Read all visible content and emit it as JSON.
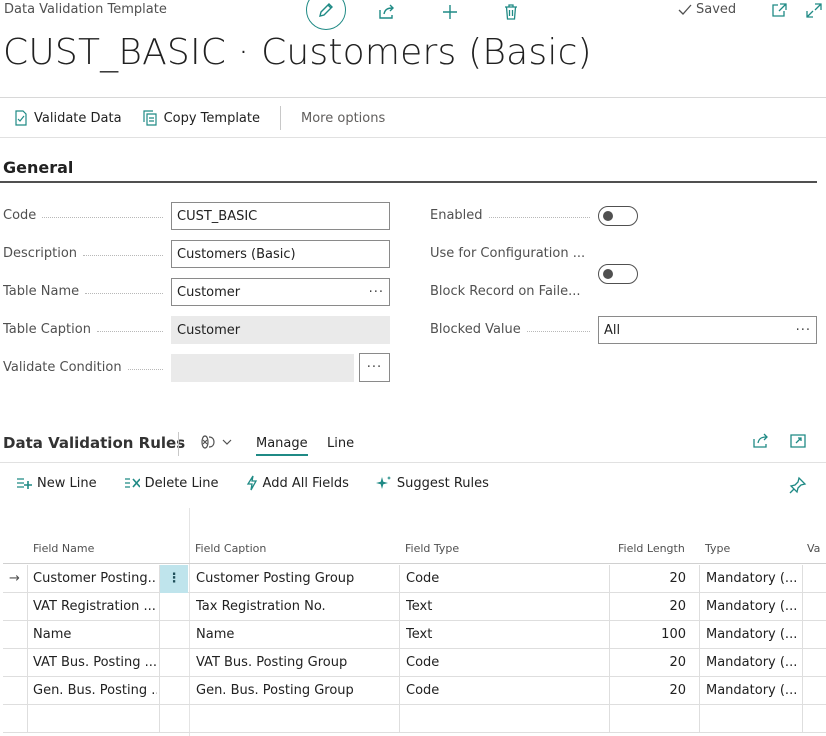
{
  "header": {
    "breadcrumb": "Data Validation Template",
    "saved_label": "Saved",
    "title": "CUST_BASIC · Customers (Basic)"
  },
  "actions": {
    "validate_data": "Validate Data",
    "copy_template": "Copy Template",
    "more_options": "More options"
  },
  "general": {
    "section_title": "General",
    "fields": {
      "code": {
        "label": "Code",
        "value": "CUST_BASIC"
      },
      "description": {
        "label": "Description",
        "value": "Customers (Basic)"
      },
      "table_name": {
        "label": "Table Name",
        "value": "Customer",
        "lookup": "···"
      },
      "table_caption": {
        "label": "Table Caption",
        "value": "Customer"
      },
      "validate_condition": {
        "label": "Validate Condition",
        "value": "",
        "lookup": "···"
      },
      "enabled": {
        "label": "Enabled",
        "value": false
      },
      "use_for_config": {
        "label": "Use for Configuration ...",
        "value": false
      },
      "block_record": {
        "label": "Block Record on Faile...",
        "value": true
      },
      "blocked_value": {
        "label": "Blocked Value",
        "value": "All",
        "lookup": "···"
      }
    }
  },
  "lines": {
    "title": "Data Validation Rules",
    "tabs": [
      "Manage",
      "Line"
    ],
    "actions": {
      "new_line": "New Line",
      "delete_line": "Delete Line",
      "add_all_fields": "Add All Fields",
      "suggest_rules": "Suggest Rules"
    },
    "columns": [
      "Field Name",
      "Field Caption",
      "Field Type",
      "Field Length",
      "Type",
      "Va"
    ],
    "rows": [
      {
        "field_name": "Customer Posting...",
        "field_caption": "Customer Posting Group",
        "field_type": "Code",
        "field_length": "20",
        "type": "Mandatory (..."
      },
      {
        "field_name": "VAT Registration ...",
        "field_caption": "Tax Registration No.",
        "field_type": "Text",
        "field_length": "20",
        "type": "Mandatory (..."
      },
      {
        "field_name": "Name",
        "field_caption": "Name",
        "field_type": "Text",
        "field_length": "100",
        "type": "Mandatory (..."
      },
      {
        "field_name": "VAT Bus. Posting ...",
        "field_caption": "VAT Bus. Posting Group",
        "field_type": "Code",
        "field_length": "20",
        "type": "Mandatory (..."
      },
      {
        "field_name": "Gen. Bus. Posting ...",
        "field_caption": "Gen. Bus. Posting Group",
        "field_type": "Code",
        "field_length": "20",
        "type": "Mandatory (..."
      }
    ],
    "row_menu_glyph": "⋮",
    "row_arrow_glyph": "→"
  },
  "colors": {
    "accent": "#1f8a85",
    "row_menu_bg": "#bfe4ec"
  }
}
